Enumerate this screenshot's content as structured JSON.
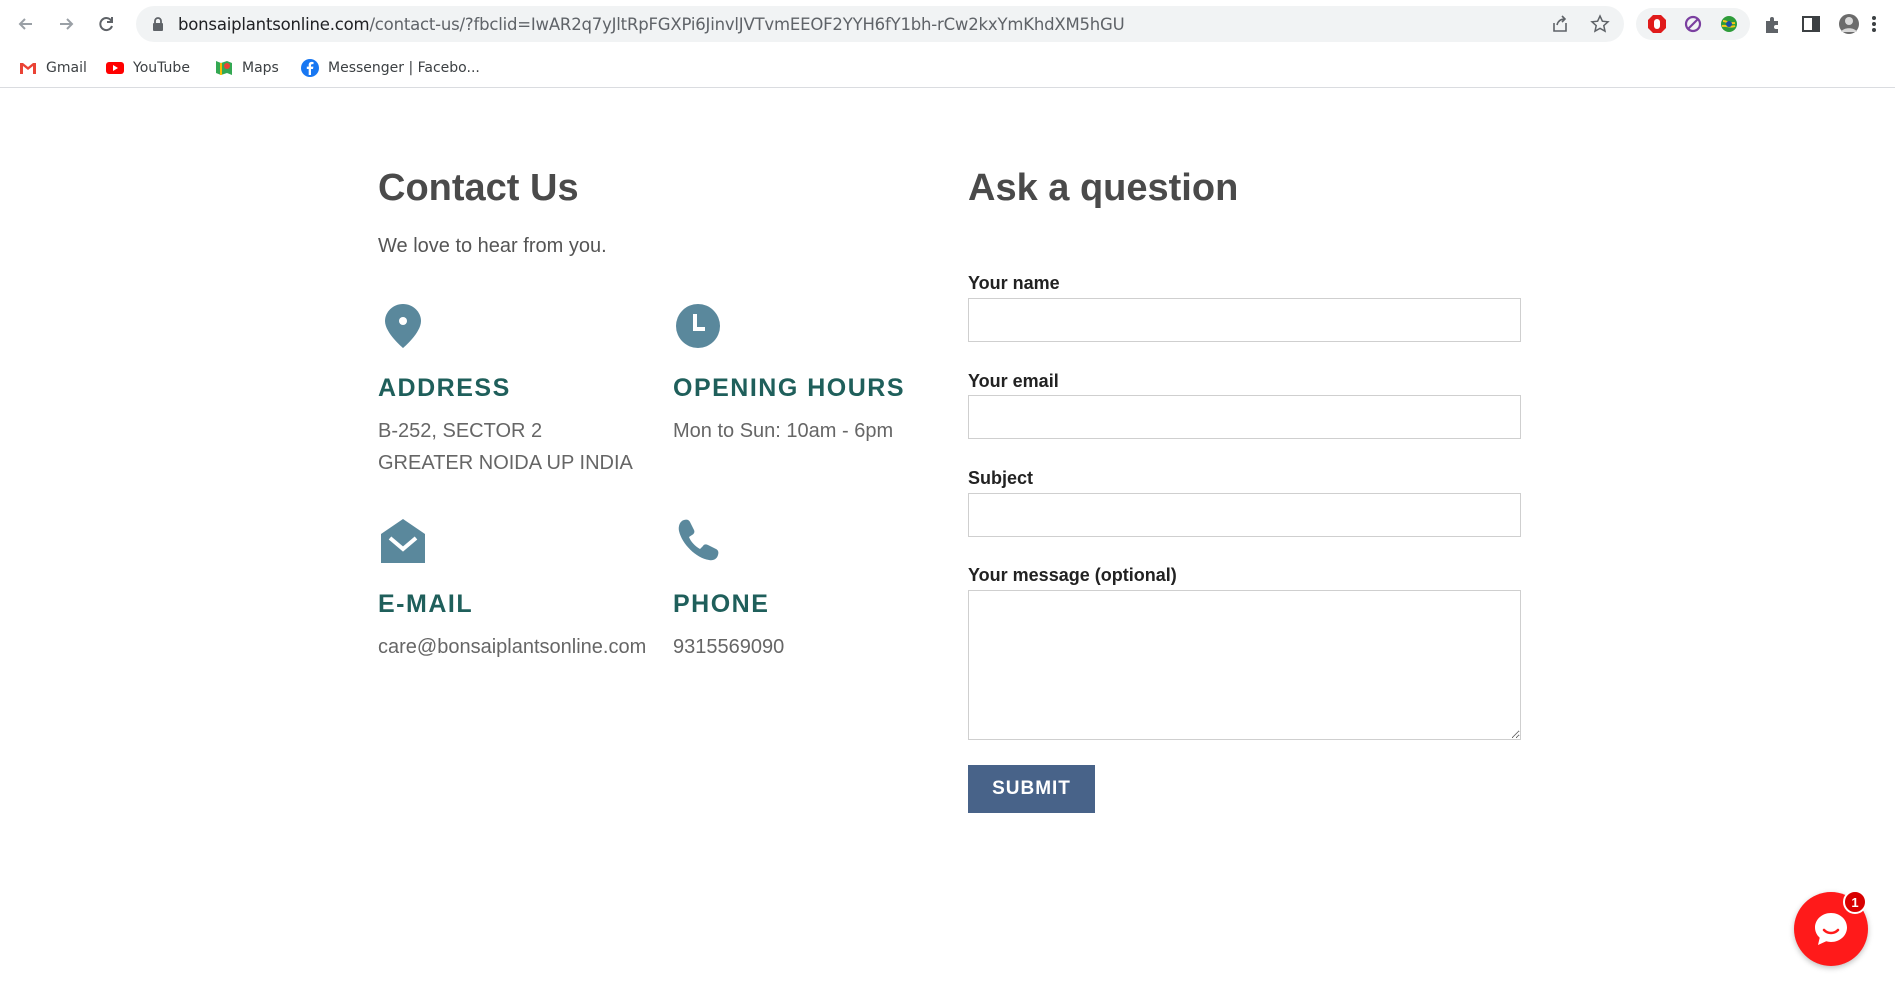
{
  "browser": {
    "url_host": "bonsaiplantsonline.com",
    "url_path": "/contact-us/?fbclid=IwAR2q7yJltRpFGXPi6JinvlJVTvmEEOF2YYH6fY1bh-rCw2kxYmKhdXM5hGU",
    "bookmarks": [
      {
        "label": "Gmail",
        "icon": "gmail-icon"
      },
      {
        "label": "YouTube",
        "icon": "youtube-icon"
      },
      {
        "label": "Maps",
        "icon": "maps-icon"
      },
      {
        "label": "Messenger | Facebo...",
        "icon": "facebook-icon"
      }
    ]
  },
  "contact": {
    "title": "Contact Us",
    "intro": "We love to hear from you.",
    "address": {
      "title": "ADDRESS",
      "line1": "B-252, SECTOR 2",
      "line2": "GREATER NOIDA UP INDIA",
      "icon": "location-pin-icon"
    },
    "hours": {
      "title": "OPENING HOURS",
      "text": "Mon to Sun: 10am - 6pm",
      "icon": "clock-icon"
    },
    "email": {
      "title": "E-MAIL",
      "text": "care@bonsaiplantsonline.com",
      "icon": "envelope-icon"
    },
    "phone": {
      "title": "PHONE",
      "text": "9315569090",
      "icon": "phone-icon"
    }
  },
  "form": {
    "title": "Ask a question",
    "name_label": "Your name",
    "email_label": "Your email",
    "subject_label": "Subject",
    "message_label": "Your message (optional)",
    "name_value": "",
    "email_value": "",
    "subject_value": "",
    "message_value": "",
    "submit_label": "SUBMIT"
  },
  "chat": {
    "badge": "1",
    "icon": "chat-bubble-icon"
  },
  "colors": {
    "heading": "#4a4a4a",
    "info_title": "#1f5f5b",
    "icon": "#5a889c",
    "button": "#486389",
    "chat": "#ff1a1a"
  }
}
